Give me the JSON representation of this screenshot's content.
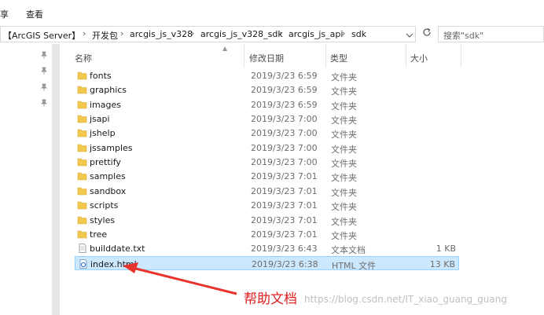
{
  "menu": {
    "share": "享",
    "view": "查看"
  },
  "address": {
    "crumbs": [
      "【ArcGIS Server】",
      "开发包",
      "arcgis_js_v328",
      "arcgis_js_v328_sdk",
      "arcgis_js_api",
      "sdk"
    ],
    "separator": "›"
  },
  "search": {
    "placeholder": "搜索\"sdk\""
  },
  "columns": {
    "name": "名称",
    "date": "修改日期",
    "type": "类型",
    "size": "大小"
  },
  "files": [
    {
      "name": "fonts",
      "date": "2019/3/23 6:59",
      "type": "文件夹",
      "size": "",
      "kind": "folder"
    },
    {
      "name": "graphics",
      "date": "2019/3/23 6:59",
      "type": "文件夹",
      "size": "",
      "kind": "folder"
    },
    {
      "name": "images",
      "date": "2019/3/23 6:59",
      "type": "文件夹",
      "size": "",
      "kind": "folder"
    },
    {
      "name": "jsapi",
      "date": "2019/3/23 7:00",
      "type": "文件夹",
      "size": "",
      "kind": "folder"
    },
    {
      "name": "jshelp",
      "date": "2019/3/23 7:00",
      "type": "文件夹",
      "size": "",
      "kind": "folder"
    },
    {
      "name": "jssamples",
      "date": "2019/3/23 7:00",
      "type": "文件夹",
      "size": "",
      "kind": "folder"
    },
    {
      "name": "prettify",
      "date": "2019/3/23 7:00",
      "type": "文件夹",
      "size": "",
      "kind": "folder"
    },
    {
      "name": "samples",
      "date": "2019/3/23 7:01",
      "type": "文件夹",
      "size": "",
      "kind": "folder"
    },
    {
      "name": "sandbox",
      "date": "2019/3/23 7:01",
      "type": "文件夹",
      "size": "",
      "kind": "folder"
    },
    {
      "name": "scripts",
      "date": "2019/3/23 7:01",
      "type": "文件夹",
      "size": "",
      "kind": "folder"
    },
    {
      "name": "styles",
      "date": "2019/3/23 7:01",
      "type": "文件夹",
      "size": "",
      "kind": "folder"
    },
    {
      "name": "tree",
      "date": "2019/3/23 7:01",
      "type": "文件夹",
      "size": "",
      "kind": "folder"
    },
    {
      "name": "builddate.txt",
      "date": "2019/3/23 6:43",
      "type": "文本文档",
      "size": "1 KB",
      "kind": "text"
    },
    {
      "name": "index.html",
      "date": "2019/3/23 6:38",
      "type": "HTML 文件",
      "size": "13 KB",
      "kind": "html",
      "selected": true
    }
  ],
  "annotation": {
    "text": "帮助文档"
  },
  "watermark": {
    "text": "https://blog.csdn.net/IT_xiao_guang_guang"
  },
  "colors": {
    "folder": "#f3c84e",
    "selection": "#cce8ff",
    "arrow": "#e8342c"
  }
}
